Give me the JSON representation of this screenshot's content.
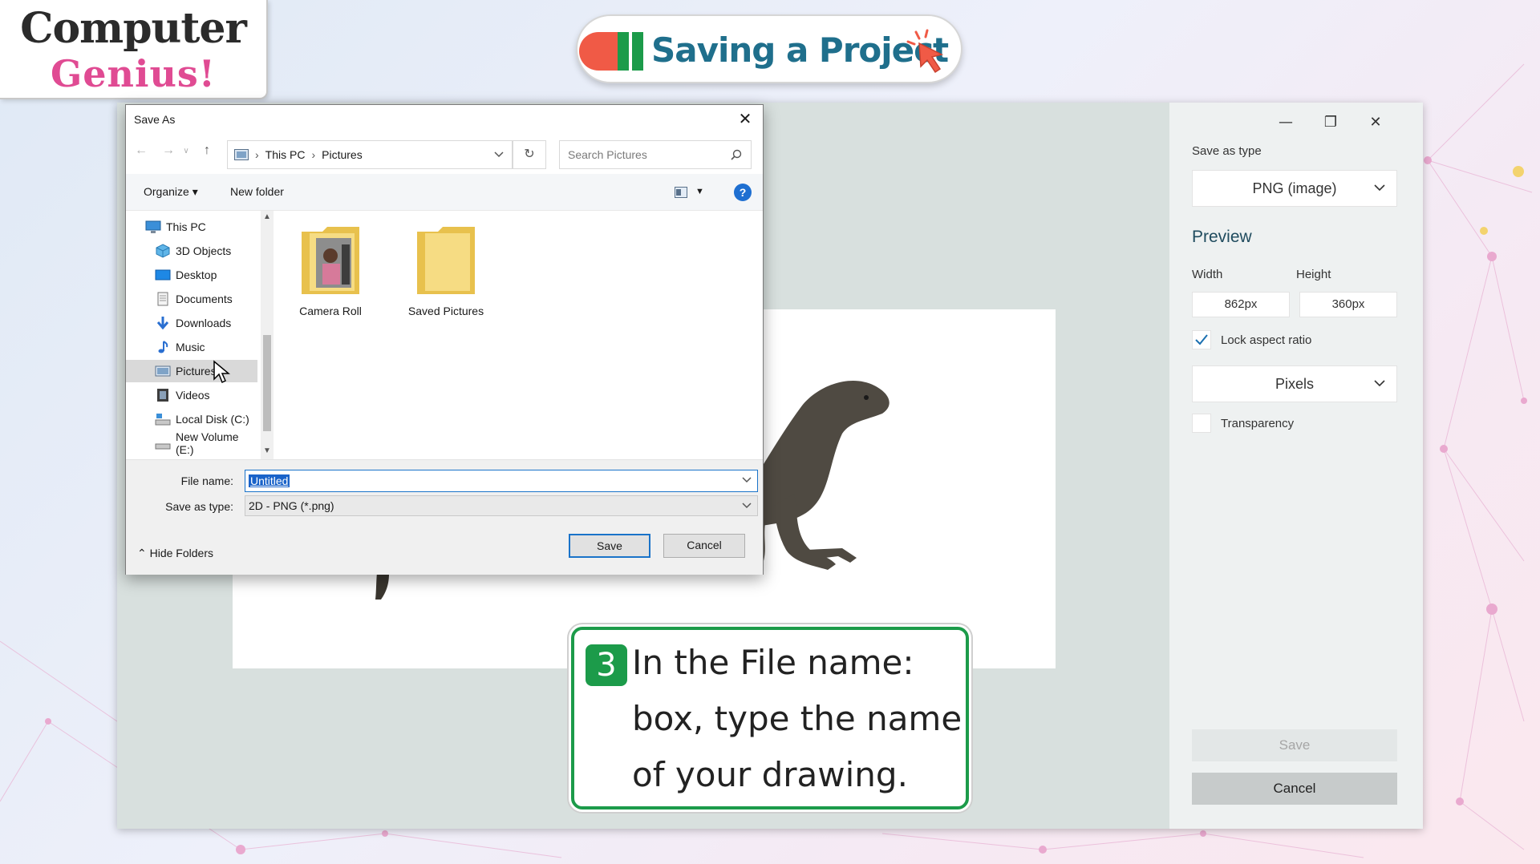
{
  "logo": {
    "line1": "Computer",
    "line2": "Genius!"
  },
  "title": "Saving a Project",
  "paint_panel": {
    "save_as_type_label": "Save as type",
    "save_as_type_value": "PNG (image)",
    "preview_heading": "Preview",
    "width_label": "Width",
    "height_label": "Height",
    "width_value": "862px",
    "height_value": "360px",
    "lock_aspect_label": "Lock aspect ratio",
    "lock_aspect_checked": true,
    "units_value": "Pixels",
    "transparency_label": "Transparency",
    "transparency_checked": false,
    "save_label": "Save",
    "cancel_label": "Cancel"
  },
  "dialog": {
    "title": "Save As",
    "breadcrumb": [
      "This PC",
      "Pictures"
    ],
    "search_placeholder": "Search Pictures",
    "organize_label": "Organize",
    "new_folder_label": "New folder",
    "nav_items": [
      {
        "label": "This PC",
        "icon": "computer-icon"
      },
      {
        "label": "3D Objects",
        "icon": "cube-icon"
      },
      {
        "label": "Desktop",
        "icon": "desktop-icon"
      },
      {
        "label": "Documents",
        "icon": "document-icon"
      },
      {
        "label": "Downloads",
        "icon": "download-icon"
      },
      {
        "label": "Music",
        "icon": "music-icon"
      },
      {
        "label": "Pictures",
        "icon": "pictures-icon"
      },
      {
        "label": "Videos",
        "icon": "video-icon"
      },
      {
        "label": "Local Disk (C:)",
        "icon": "drive-icon"
      },
      {
        "label": "New Volume (E:)",
        "icon": "drive-icon"
      }
    ],
    "selected_nav": "Pictures",
    "files": [
      {
        "label": "Camera Roll",
        "icon": "photo-folder-icon"
      },
      {
        "label": "Saved Pictures",
        "icon": "folder-icon"
      }
    ],
    "file_name_label": "File name:",
    "file_name_value": "Untitled",
    "save_type_label": "Save as type:",
    "save_type_value": "2D - PNG (*.png)",
    "save_button": "Save",
    "cancel_button": "Cancel",
    "hide_folders_label": "Hide Folders"
  },
  "callout": {
    "step_number": "3",
    "lines": [
      "In the File name:",
      "box, type the name",
      "of your drawing."
    ]
  },
  "colors": {
    "accent_green": "#1c9b4a",
    "title_blue": "#1f6f8c",
    "logo_pink": "#e04b93",
    "selection_blue": "#1a63c9"
  }
}
